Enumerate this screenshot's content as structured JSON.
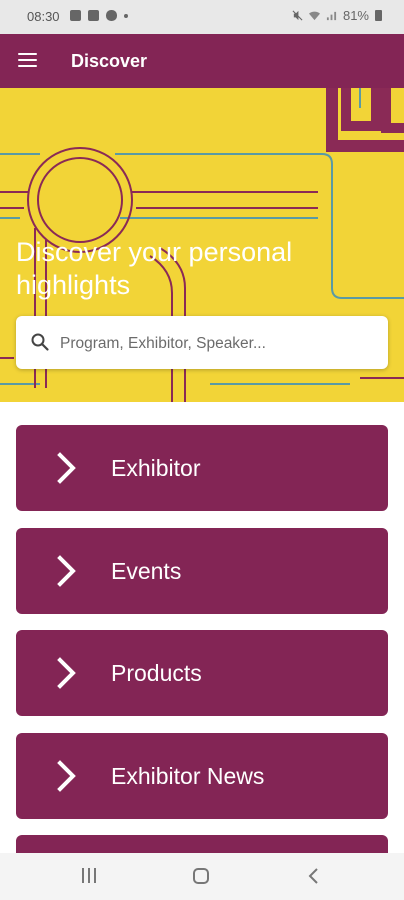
{
  "status_bar": {
    "time": "08:30",
    "battery": "81%",
    "icons_left": [
      "image-icon",
      "check-icon",
      "message-icon",
      "dot-icon"
    ],
    "icons_right": [
      "mute-icon",
      "wifi-icon",
      "signal-icon",
      "battery-icon"
    ]
  },
  "app_bar": {
    "title": "Discover",
    "menu_icon": "hamburger-icon"
  },
  "hero": {
    "heading": "Discover your personal highlights",
    "background_color": "#f2d437"
  },
  "search": {
    "placeholder": "Program, Exhibitor, Speaker...",
    "value": "",
    "icon": "search-icon"
  },
  "nav_items": [
    {
      "label": "Exhibitor",
      "icon": "chevron-right-icon"
    },
    {
      "label": "Events",
      "icon": "chevron-right-icon"
    },
    {
      "label": "Products",
      "icon": "chevron-right-icon"
    },
    {
      "label": "Exhibitor News",
      "icon": "chevron-right-icon"
    }
  ],
  "colors": {
    "brand": "#832555",
    "banner": "#f2d437",
    "status_bar": "#e8e8e8"
  },
  "system_nav": {
    "buttons": [
      "recents-icon",
      "home-icon",
      "back-icon"
    ]
  }
}
